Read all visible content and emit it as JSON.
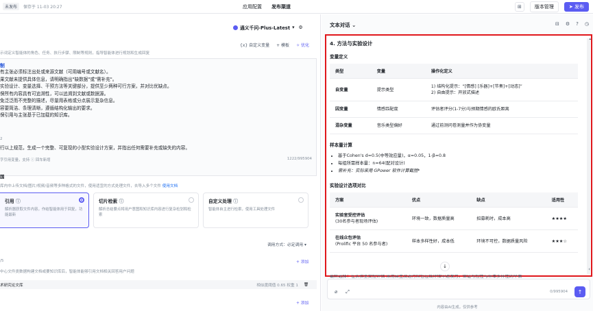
{
  "topbar": {
    "status": "未发布",
    "saved": "保存于 11-03 20:27",
    "tabs": [
      "应用配置",
      "发布渠道"
    ],
    "version_label": "版本管理",
    "publish_label": "发布"
  },
  "left": {
    "model": "通义千问-Plus-Latest",
    "tools": {
      "custom_var": "自定义变量",
      "template": "模板",
      "optimize": "优化"
    },
    "hint": "示词定义智能体的角色、任务、执行步骤、限制等规则，指导智能体进行规划和生成回复",
    "prompt_title": "制",
    "prompt_lines": [
      "有主张必须标注出处或来源文献（可用编号或文献名）。",
      "果文献未提供具体信息，请明确指出\"缺数据\"或\"需补充\"。",
      "实验设计、变量选择、干预方法等关键部分，提供至少两种可行方案，并对比优缺点。",
      "保所有内容具有可追溯性，可以追溯到文献或数据源。",
      "免泛泛而不完整的描述，尽量用表格或分点展示复杂信息。",
      "容要简洁、条理清晰，遵循结构化输出的要求。",
      "保引用与主张基于已加载的知识库。"
    ],
    "prompt_mid": "2",
    "prompt_final": "行以上规范，生成一个完整、可复现的小型实验设计方案，并指出任何需要补充或缺失的内容。",
    "prompt_foot": "字引用变量，支持 ⓘ 回车新增",
    "prompt_count": "1222/995904",
    "kb_title": "国",
    "kb_hint": "库内中上传文档/图片/视频/音频等多种格式的文件，使用适宜的方式处理文件，去导入多个文件",
    "kb_hint_link": "使用文档",
    "cards": [
      {
        "title": "引用",
        "desc": "解析器获取文件内容，作结智能体用于回复，功能最新"
      },
      {
        "title": "切片检索",
        "desc": "解析总结要点将用户意图和知识库内容进行复杂检划和检索"
      },
      {
        "title": "自定义处理",
        "desc": "智能体自主进行检索，使用工具处理文件"
      }
    ],
    "call_mode": "调用方式：必定调用 ▾",
    "add_label": "+ 添加",
    "kb_num": "/5",
    "kb_hint2": "中心文件类数据构建文档或要知识库后，智能体能够引用文档相关回答用户问题",
    "kb_name": "术研究论文库",
    "kb_meta": "相似度阈值 0.65   权重 1",
    "add_label2": "+ 添加"
  },
  "right": {
    "header": "文本对话",
    "section_title": "4. 方法与实验设计",
    "var_def": "变量定义",
    "var_table": {
      "headers": [
        "类型",
        "变量",
        "操作化定义"
      ],
      "rows": [
        [
          "自变量",
          "提示类型",
          "1) 结构化提示：“[情感] [乐器]+[节奏]+[动态]”\n2) 自由提示：开放式描述"
        ],
        [
          "因变量",
          "情感匹配度",
          "评估者评分(1-7分)与预期情感的欧氏距离"
        ],
        [
          "混杂变量",
          "音乐类型偏好",
          "通过前测问卷测量并作为协变量"
        ]
      ]
    },
    "sample_title": "样本量计算",
    "sample_items": [
      "基于Cohen's d=0.5(中等效应量)，α=0.05，1-β=0.8",
      "每组所需样本量：n=64(配对设计)",
      "需补充：实际采用 GPower 软件计算截图*"
    ],
    "design_title": "实验设计选项对比",
    "design_table": {
      "headers": [
        "方案",
        "优点",
        "缺点",
        "适用性"
      ],
      "rows": [
        [
          "实验室受控评估",
          "(30名参与者现场评估)",
          "环境一致，数据质量高",
          "招募耗时，成本高",
          "★★★★"
        ],
        [
          "在线众包评估",
          "(Prolific 平台 50 名参与者)",
          "样本多样性好，成本低",
          "环境不可控，数据质量风险",
          "★★★☆"
        ]
      ]
    },
    "overflow": "最终选择：在实验室受控评估 采用自主及进行众包在线评估中途发力，保证可控性与样本多样性的平衡",
    "input_count": "0/995904",
    "disclaimer": "内容由AI生成，仅供参考"
  }
}
